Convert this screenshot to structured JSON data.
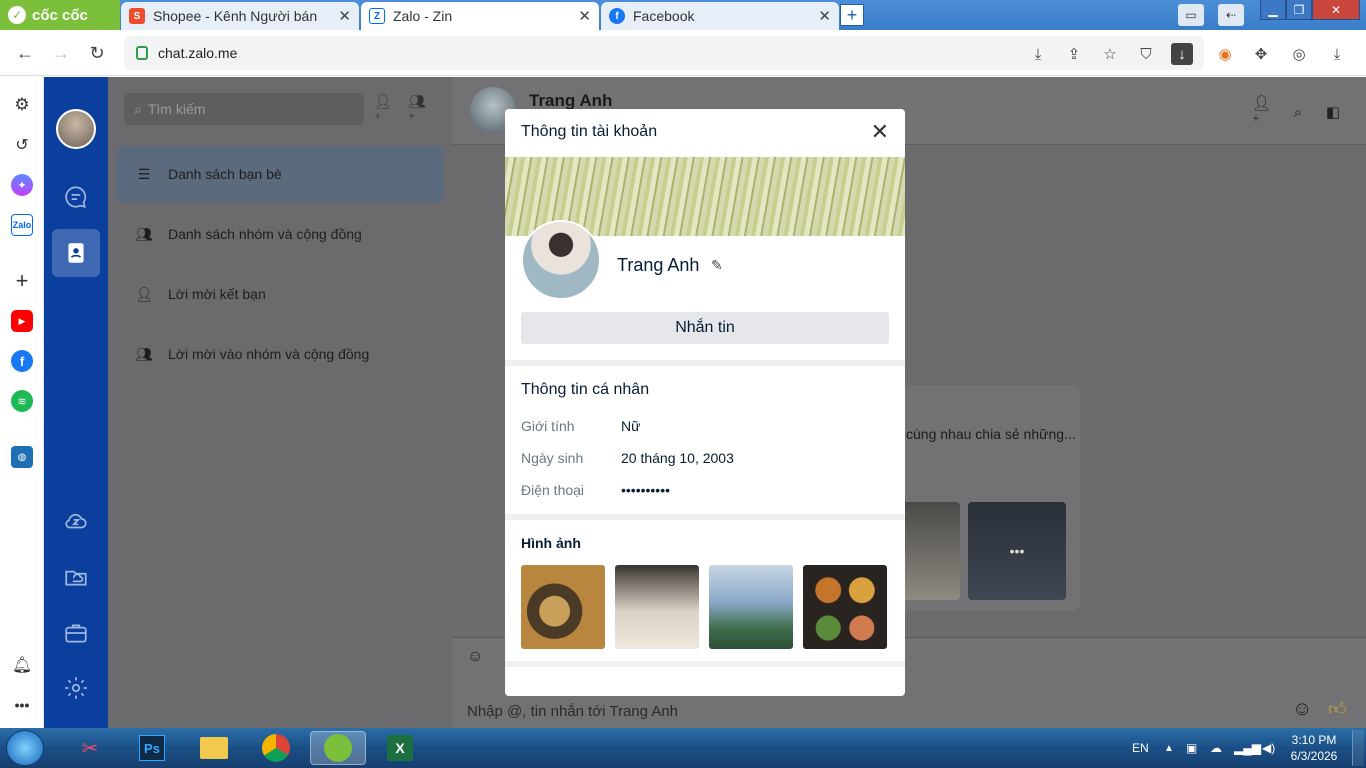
{
  "browser": {
    "brand": "cốc cốc",
    "tabs": [
      {
        "label": "Shopee - Kênh Người bán",
        "icon_color": "#ee4d2d"
      },
      {
        "label": "Zalo - Zin",
        "icon_color": "#0068ff"
      },
      {
        "label": "Facebook",
        "icon_color": "#1877f2"
      }
    ],
    "url": "chat.zalo.me"
  },
  "contacts": {
    "search_placeholder": "Tìm kiếm",
    "items": [
      {
        "label": "Danh sách bạn bè"
      },
      {
        "label": "Danh sách nhóm và cộng đồng"
      },
      {
        "label": "Lời mời kết bạn"
      },
      {
        "label": "Lời mời vào nhóm và cộng đồng"
      }
    ]
  },
  "chat": {
    "contact_name": "Trang Anh",
    "message_preview": "cùng nhau chia sẻ những...",
    "composer_placeholder": "Nhập @, tin nhắn tới Trang Anh"
  },
  "modal": {
    "title": "Thông tin tài khoản",
    "name": "Trang Anh",
    "message_button": "Nhắn tin",
    "personal_info_title": "Thông tin cá nhân",
    "fields": [
      {
        "label": "Giới tính",
        "value": "Nữ"
      },
      {
        "label": "Ngày sinh",
        "value": "20 tháng 10, 2003"
      },
      {
        "label": "Điện thoại",
        "value": "••••••••••"
      }
    ],
    "photos_title": "Hình ảnh"
  },
  "taskbar": {
    "lang": "EN",
    "time": "3:10 PM",
    "date": "6/3/2026"
  },
  "colors": {
    "zalo_nav": "#0a3f9e",
    "overlay_gray": "#6b6b6d",
    "brand_green": "#7cbf3b"
  }
}
